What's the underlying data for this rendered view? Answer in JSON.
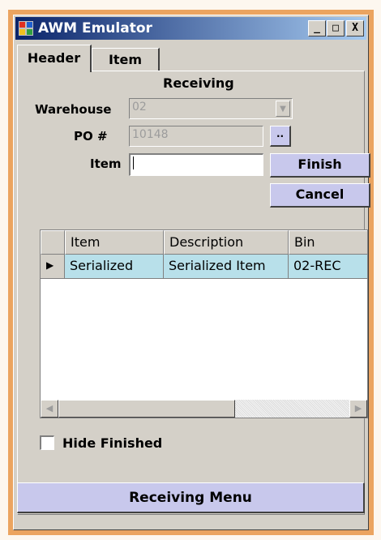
{
  "window": {
    "title": "AWM Emulator",
    "minimize": "_",
    "maximize": "□",
    "close": "X"
  },
  "tabs": [
    {
      "label": "Header",
      "active": true
    },
    {
      "label": "Item",
      "active": false
    }
  ],
  "form": {
    "heading": "Receiving",
    "warehouse_label": "Warehouse",
    "warehouse_value": "02",
    "po_label": "PO #",
    "po_value": "10148",
    "browse_label": "..",
    "item_label": "Item",
    "item_value": "",
    "finish_label": "Finish",
    "cancel_label": "Cancel"
  },
  "grid": {
    "columns": [
      "Item",
      "Description",
      "Bin"
    ],
    "rows": [
      [
        "Serialized",
        "Serialized Item",
        "02-REC"
      ]
    ],
    "row_indicator": "▶"
  },
  "hide_finished": {
    "label": "Hide Finished",
    "checked": false
  },
  "menu_button": "Receiving Menu",
  "colors": {
    "frame": "#eba460",
    "title_start": "#0a246a",
    "button_bg": "#c8c8ec",
    "row_selected": "#b8e0ea"
  }
}
